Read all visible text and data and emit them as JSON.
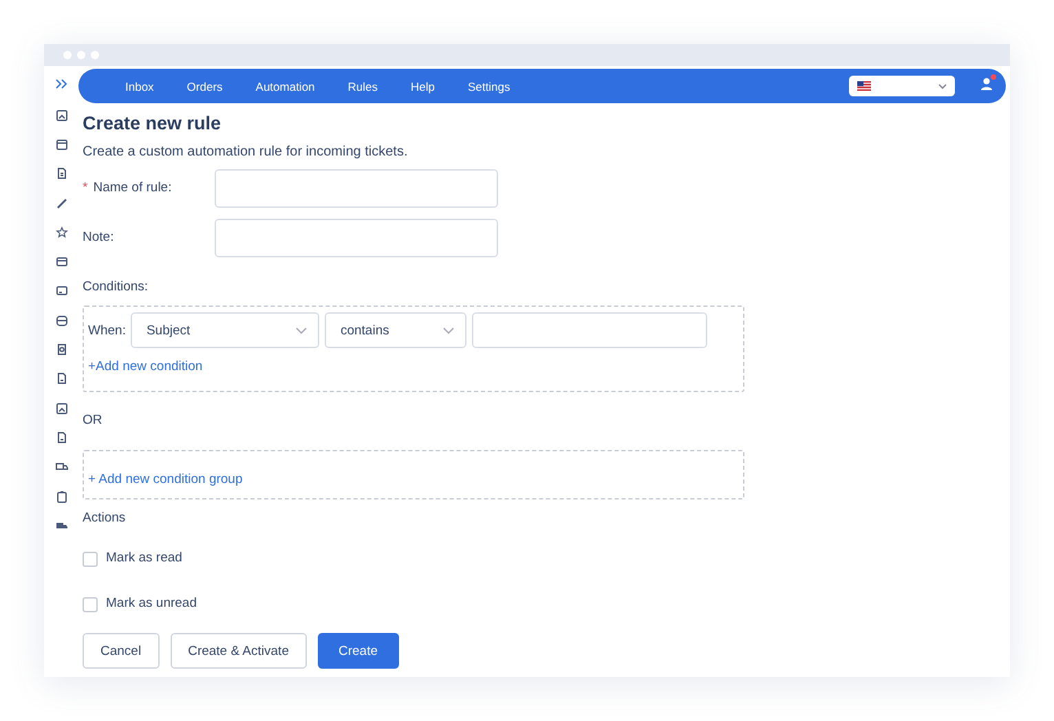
{
  "nav": {
    "items": [
      "Inbox",
      "Orders",
      "Automation",
      "Rules",
      "Help",
      "Settings"
    ],
    "user_notification": true
  },
  "form": {
    "title": "Create new rule",
    "subtitle": "Create a custom automation rule for incoming tickets.",
    "fields": [
      {
        "label": "Name of rule:",
        "required_mark": "*"
      },
      {
        "label": "Note:"
      }
    ],
    "conditions": {
      "label": "Conditions:",
      "groups": [
        {
          "when_label": "When:",
          "field": "Subject",
          "operator": "contains",
          "add_link": "+Add new condition"
        }
      ],
      "separator": "OR",
      "add_group": "+ Add new condition group"
    },
    "actions": {
      "label": "Actions",
      "items": [
        {
          "label": "Mark as read",
          "checked": false
        },
        {
          "label": "Mark as unread",
          "checked": false
        }
      ]
    },
    "buttons": [
      {
        "label": "Cancel",
        "kind": "default"
      },
      {
        "label": "Create & Activate",
        "kind": "default"
      },
      {
        "label": "Create",
        "kind": "primary"
      }
    ]
  }
}
